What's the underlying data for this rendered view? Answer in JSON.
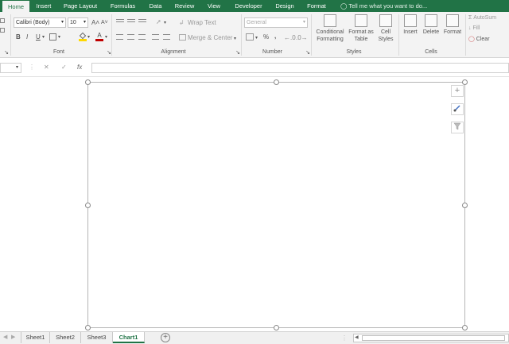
{
  "tabs": {
    "home": "Home",
    "insert": "Insert",
    "page_layout": "Page Layout",
    "formulas": "Formulas",
    "data": "Data",
    "review": "Review",
    "view": "View",
    "developer": "Developer",
    "design": "Design",
    "format": "Format",
    "tell_me": "Tell me what you want to do..."
  },
  "font": {
    "name": "Calibri (Body)",
    "size": "10",
    "bold": "B",
    "italic": "I",
    "underline": "U",
    "grow": "A˄",
    "shrink": "A˅",
    "group_label": "Font"
  },
  "alignment": {
    "wrap_text": "Wrap Text",
    "merge_center": "Merge & Center",
    "group_label": "Alignment"
  },
  "number": {
    "format": "General",
    "percent": "%",
    "comma": ",",
    "group_label": "Number"
  },
  "styles": {
    "conditional_line1": "Conditional",
    "conditional_line2": "Formatting",
    "format_table_line1": "Format as",
    "format_table_line2": "Table",
    "cell_styles_line1": "Cell",
    "cell_styles_line2": "Styles",
    "group_label": "Styles"
  },
  "cells": {
    "insert": "Insert",
    "delete": "Delete",
    "format": "Format",
    "group_label": "Cells"
  },
  "editing": {
    "autosum": "AutoSum",
    "fill": "Fill",
    "clear": "Clear"
  },
  "formula_bar": {
    "fx": "fx",
    "cancel": "✕",
    "enter": "✓",
    "value": ""
  },
  "sheets": [
    "Sheet1",
    "Sheet2",
    "Sheet3",
    "Chart1"
  ],
  "active_sheet": "Chart1",
  "colors": {
    "accent": "#217346",
    "font_red": "#c00000",
    "fill_yellow": "#ffd800"
  }
}
